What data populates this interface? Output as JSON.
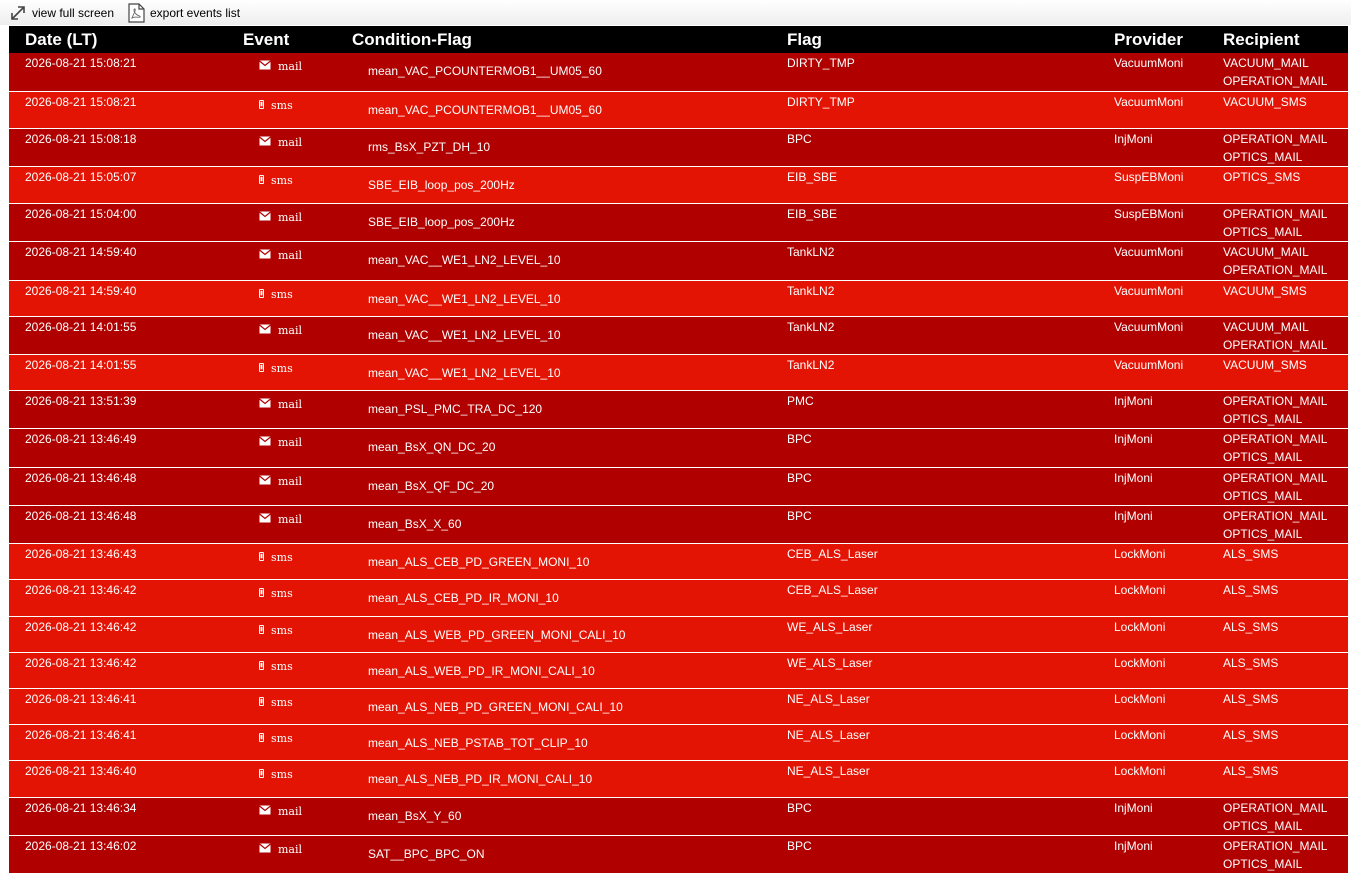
{
  "toolbar": {
    "full_screen_label": "view full screen",
    "export_label": "export events list",
    "full_screen_icon": "expand-arrows-icon",
    "export_icon": "pdf-document-icon"
  },
  "table": {
    "headers": {
      "date": "Date (LT)",
      "event": "Event",
      "condition": "Condition-Flag",
      "flag": "Flag",
      "provider": "Provider",
      "recipient": "Recipient"
    },
    "colors": {
      "header_bg": "#000000",
      "mail_row_bg": "#b00000",
      "sms_row_bg": "#e41405",
      "text": "#ffffff"
    },
    "rows": [
      {
        "date": "2026-08-21 15:08:21",
        "event": "mail",
        "condition": "mean_VAC_PCOUNTERMOB1__UM05_60",
        "flag": "DIRTY_TMP",
        "provider": "VacuumMoni",
        "recipients": [
          "VACUUM_MAIL",
          "OPERATION_MAIL"
        ]
      },
      {
        "date": "2026-08-21 15:08:21",
        "event": "sms",
        "condition": "mean_VAC_PCOUNTERMOB1__UM05_60",
        "flag": "DIRTY_TMP",
        "provider": "VacuumMoni",
        "recipients": [
          "VACUUM_SMS"
        ]
      },
      {
        "date": "2026-08-21 15:08:18",
        "event": "mail",
        "condition": "rms_BsX_PZT_DH_10",
        "flag": "BPC",
        "provider": "InjMoni",
        "recipients": [
          "OPERATION_MAIL",
          "OPTICS_MAIL"
        ]
      },
      {
        "date": "2026-08-21 15:05:07",
        "event": "sms",
        "condition": "SBE_EIB_loop_pos_200Hz",
        "flag": "EIB_SBE",
        "provider": "SuspEBMoni",
        "recipients": [
          "OPTICS_SMS"
        ]
      },
      {
        "date": "2026-08-21 15:04:00",
        "event": "mail",
        "condition": "SBE_EIB_loop_pos_200Hz",
        "flag": "EIB_SBE",
        "provider": "SuspEBMoni",
        "recipients": [
          "OPERATION_MAIL",
          "OPTICS_MAIL"
        ]
      },
      {
        "date": "2026-08-21 14:59:40",
        "event": "mail",
        "condition": "mean_VAC__WE1_LN2_LEVEL_10",
        "flag": "TankLN2",
        "provider": "VacuumMoni",
        "recipients": [
          "VACUUM_MAIL",
          "OPERATION_MAIL"
        ]
      },
      {
        "date": "2026-08-21 14:59:40",
        "event": "sms",
        "condition": "mean_VAC__WE1_LN2_LEVEL_10",
        "flag": "TankLN2",
        "provider": "VacuumMoni",
        "recipients": [
          "VACUUM_SMS"
        ]
      },
      {
        "date": "2026-08-21 14:01:55",
        "event": "mail",
        "condition": "mean_VAC__WE1_LN2_LEVEL_10",
        "flag": "TankLN2",
        "provider": "VacuumMoni",
        "recipients": [
          "VACUUM_MAIL",
          "OPERATION_MAIL"
        ]
      },
      {
        "date": "2026-08-21 14:01:55",
        "event": "sms",
        "condition": "mean_VAC__WE1_LN2_LEVEL_10",
        "flag": "TankLN2",
        "provider": "VacuumMoni",
        "recipients": [
          "VACUUM_SMS"
        ]
      },
      {
        "date": "2026-08-21 13:51:39",
        "event": "mail",
        "condition": "mean_PSL_PMC_TRA_DC_120",
        "flag": "PMC",
        "provider": "InjMoni",
        "recipients": [
          "OPERATION_MAIL",
          "OPTICS_MAIL"
        ]
      },
      {
        "date": "2026-08-21 13:46:49",
        "event": "mail",
        "condition": "mean_BsX_QN_DC_20",
        "flag": "BPC",
        "provider": "InjMoni",
        "recipients": [
          "OPERATION_MAIL",
          "OPTICS_MAIL"
        ]
      },
      {
        "date": "2026-08-21 13:46:48",
        "event": "mail",
        "condition": "mean_BsX_QF_DC_20",
        "flag": "BPC",
        "provider": "InjMoni",
        "recipients": [
          "OPERATION_MAIL",
          "OPTICS_MAIL"
        ]
      },
      {
        "date": "2026-08-21 13:46:48",
        "event": "mail",
        "condition": "mean_BsX_X_60",
        "flag": "BPC",
        "provider": "InjMoni",
        "recipients": [
          "OPERATION_MAIL",
          "OPTICS_MAIL"
        ]
      },
      {
        "date": "2026-08-21 13:46:43",
        "event": "sms",
        "condition": "mean_ALS_CEB_PD_GREEN_MONI_10",
        "flag": "CEB_ALS_Laser",
        "provider": "LockMoni",
        "recipients": [
          "ALS_SMS"
        ]
      },
      {
        "date": "2026-08-21 13:46:42",
        "event": "sms",
        "condition": "mean_ALS_CEB_PD_IR_MONI_10",
        "flag": "CEB_ALS_Laser",
        "provider": "LockMoni",
        "recipients": [
          "ALS_SMS"
        ]
      },
      {
        "date": "2026-08-21 13:46:42",
        "event": "sms",
        "condition": "mean_ALS_WEB_PD_GREEN_MONI_CALI_10",
        "flag": "WE_ALS_Laser",
        "provider": "LockMoni",
        "recipients": [
          "ALS_SMS"
        ]
      },
      {
        "date": "2026-08-21 13:46:42",
        "event": "sms",
        "condition": "mean_ALS_WEB_PD_IR_MONI_CALI_10",
        "flag": "WE_ALS_Laser",
        "provider": "LockMoni",
        "recipients": [
          "ALS_SMS"
        ]
      },
      {
        "date": "2026-08-21 13:46:41",
        "event": "sms",
        "condition": "mean_ALS_NEB_PD_GREEN_MONI_CALI_10",
        "flag": "NE_ALS_Laser",
        "provider": "LockMoni",
        "recipients": [
          "ALS_SMS"
        ]
      },
      {
        "date": "2026-08-21 13:46:41",
        "event": "sms",
        "condition": "mean_ALS_NEB_PSTAB_TOT_CLIP_10",
        "flag": "NE_ALS_Laser",
        "provider": "LockMoni",
        "recipients": [
          "ALS_SMS"
        ]
      },
      {
        "date": "2026-08-21 13:46:40",
        "event": "sms",
        "condition": "mean_ALS_NEB_PD_IR_MONI_CALI_10",
        "flag": "NE_ALS_Laser",
        "provider": "LockMoni",
        "recipients": [
          "ALS_SMS"
        ]
      },
      {
        "date": "2026-08-21 13:46:34",
        "event": "mail",
        "condition": "mean_BsX_Y_60",
        "flag": "BPC",
        "provider": "InjMoni",
        "recipients": [
          "OPERATION_MAIL",
          "OPTICS_MAIL"
        ]
      },
      {
        "date": "2026-08-21 13:46:02",
        "event": "mail",
        "condition": "SAT__BPC_BPC_ON",
        "flag": "BPC",
        "provider": "InjMoni",
        "recipients": [
          "OPERATION_MAIL",
          "OPTICS_MAIL"
        ]
      }
    ]
  }
}
